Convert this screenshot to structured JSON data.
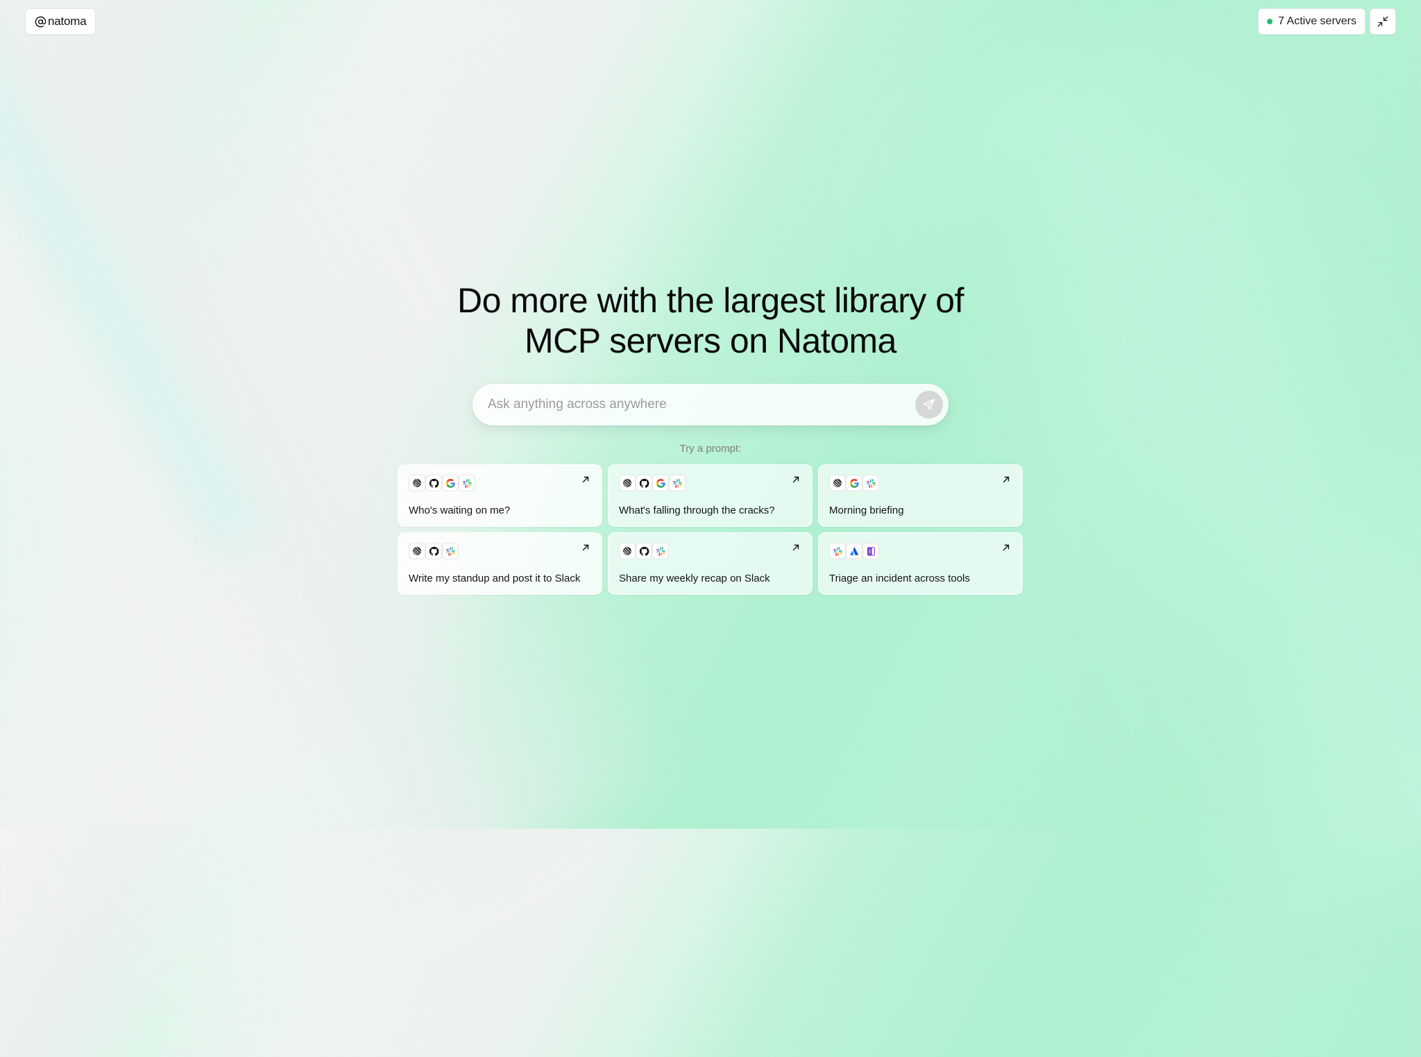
{
  "header": {
    "logo_text": "natoma",
    "status_text": "7 Active servers",
    "status_color": "#1fbf73"
  },
  "hero": {
    "title_line1": "Do more with the largest library of",
    "title_line2": "MCP servers on Natoma"
  },
  "search": {
    "placeholder": "Ask anything across anywhere",
    "value": ""
  },
  "prompts": {
    "label": "Try a prompt:",
    "items": [
      {
        "label": "Who's waiting on me?",
        "icons": [
          "linear-icon",
          "github-icon",
          "google-icon",
          "slack-icon"
        ]
      },
      {
        "label": "What's falling through the cracks?",
        "icons": [
          "linear-icon",
          "github-icon",
          "google-icon",
          "slack-icon"
        ]
      },
      {
        "label": "Morning briefing",
        "icons": [
          "linear-icon",
          "google-icon",
          "slack-icon"
        ]
      },
      {
        "label": "Write my standup and post it to Slack",
        "icons": [
          "linear-icon",
          "github-icon",
          "slack-icon"
        ]
      },
      {
        "label": "Share my weekly recap on Slack",
        "icons": [
          "linear-icon",
          "github-icon",
          "slack-icon"
        ]
      },
      {
        "label": "Triage an incident across tools",
        "icons": [
          "slack-icon",
          "atlassian-icon",
          "onenote-icon"
        ]
      }
    ]
  },
  "colors": {
    "accent_green": "#1fbf73",
    "background_green": "#aef0cf"
  }
}
